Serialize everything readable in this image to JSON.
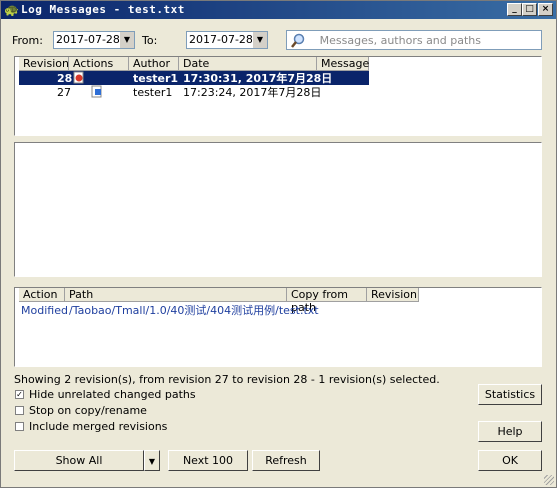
{
  "window": {
    "title": "Log Messages - test.txt"
  },
  "filter": {
    "from_label": "From:",
    "from_date": "2017-07-28",
    "to_label": "To:",
    "to_date": "2017-07-28",
    "search_placeholder": "Messages, authors and paths"
  },
  "revisions": {
    "headers": [
      "Revision",
      "Actions",
      "Author",
      "Date",
      "Message"
    ],
    "rows": [
      {
        "revision": "28",
        "author": "tester1",
        "date": "17:30:31, 2017年7月28日",
        "message": "",
        "selected": true
      },
      {
        "revision": "27",
        "author": "tester1",
        "date": "17:23:24, 2017年7月28日",
        "message": "",
        "selected": false
      }
    ]
  },
  "paths": {
    "headers": [
      "Action",
      "Path",
      "Copy from path",
      "Revision"
    ],
    "rows": [
      {
        "action": "Modified",
        "path": "/Taobao/Tmall/1.0/40测试/404测试用例/test.txt",
        "copy_from": "",
        "revision": ""
      }
    ]
  },
  "status_text": "Showing 2 revision(s), from revision 27 to revision 28 - 1 revision(s) selected.",
  "options": {
    "hide_unrelated": {
      "label": "Hide unrelated changed paths",
      "checked": true,
      "mark": "✓"
    },
    "stop_on_copy": {
      "label": "Stop on copy/rename",
      "checked": false
    },
    "include_merged": {
      "label": "Include merged revisions",
      "checked": false
    }
  },
  "buttons": {
    "show_all": "Show All",
    "next_100": "Next 100",
    "refresh": "Refresh",
    "statistics": "Statistics",
    "help": "Help",
    "ok": "OK"
  },
  "colors": {
    "selection": "#0a246a",
    "path_text": "#1f3f9f"
  }
}
